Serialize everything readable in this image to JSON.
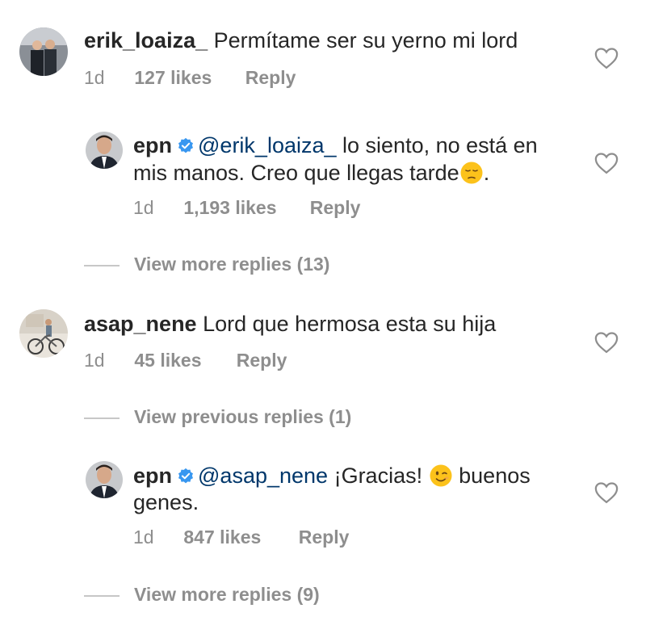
{
  "comments": [
    {
      "username": "erik_loaiza_",
      "text": "Permítame ser su yerno mi lord",
      "time": "1d",
      "likes": "127 likes",
      "reply": "Reply",
      "replies": [
        {
          "username": "epn",
          "verified": true,
          "mention": "@erik_loaiza_",
          "text_line1": "lo siento, no está en",
          "text_line2": "mis manos. Creo que llegas tarde",
          "text_line2_end": ".",
          "emoji": "pensive-face",
          "time": "1d",
          "likes": "1,193 likes",
          "reply": "Reply"
        }
      ],
      "view_more": "View more replies (13)"
    },
    {
      "username": "asap_nene",
      "text": "Lord que hermosa esta su hija",
      "time": "1d",
      "likes": "45 likes",
      "reply": "Reply",
      "view_previous": "View previous replies (1)",
      "replies": [
        {
          "username": "epn",
          "verified": true,
          "mention": "@asap_nene",
          "text_line1_a": "¡Gracias!",
          "text_line1_b": "buenos",
          "text_line2": "genes.",
          "emoji": "winking-face",
          "time": "1d",
          "likes": "847 likes",
          "reply": "Reply"
        }
      ],
      "view_more": "View more replies (9)"
    }
  ],
  "colors": {
    "text": "#262626",
    "muted": "#8e8e8e",
    "mention": "#00376b",
    "verified": "#3897f0"
  }
}
